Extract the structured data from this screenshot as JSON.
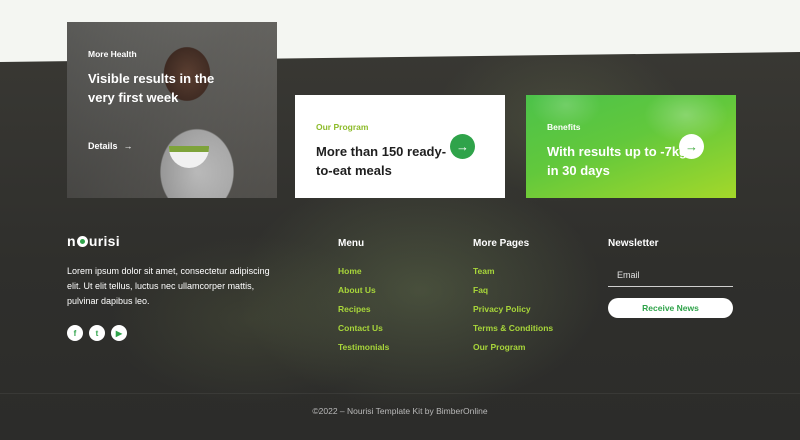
{
  "cards": [
    {
      "eyebrow": "More Health",
      "title": "Visible results in the very first week",
      "link": "Details"
    },
    {
      "eyebrow": "Our Program",
      "title": "More than 150 ready-to-eat meals"
    },
    {
      "eyebrow": "Benefits",
      "title": "With results up to -7kg in 30 days"
    }
  ],
  "footer": {
    "logo": {
      "prefix": "n",
      "suffix": "urisi"
    },
    "about": "Lorem ipsum dolor sit amet, consectetur adipiscing elit. Ut elit tellus, luctus nec ullamcorper mattis, pulvinar dapibus leo.",
    "socials": [
      {
        "icon": "facebook-icon",
        "glyph": "f"
      },
      {
        "icon": "twitter-icon",
        "glyph": "t"
      },
      {
        "icon": "youtube-icon",
        "glyph": "▶"
      }
    ],
    "menu": {
      "title": "Menu",
      "items": [
        "Home",
        "About Us",
        "Recipes",
        "Contact Us",
        "Testimonials"
      ]
    },
    "more_pages": {
      "title": "More Pages",
      "items": [
        "Team",
        "Faq",
        "Privacy Policy",
        "Terms & Conditions",
        "Our Program"
      ]
    },
    "newsletter": {
      "title": "Newsletter",
      "email_placeholder": "Email",
      "button_label": "Receive News"
    },
    "copyright": "©2022 – Nourisi Template Kit by BimberOnline"
  },
  "colors": {
    "accent_green": "#2fa34a",
    "link_lime": "#a8d63a",
    "dark_bg": "#2f2f2c"
  }
}
